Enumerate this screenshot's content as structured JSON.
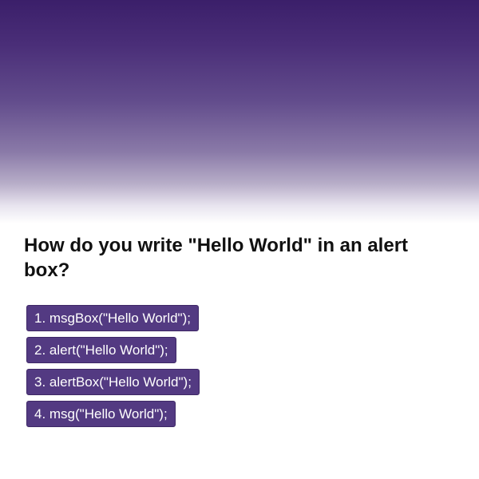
{
  "quiz": {
    "question": "How do you write \"Hello World\" in an alert box?",
    "answers": [
      "1. msgBox(\"Hello World\");",
      "2. alert(\"Hello World\");",
      "3. alertBox(\"Hello World\");",
      "4. msg(\"Hello World\");"
    ]
  },
  "theme": {
    "accent": "#533a82",
    "header_gradient_top": "#3b1f6a"
  }
}
